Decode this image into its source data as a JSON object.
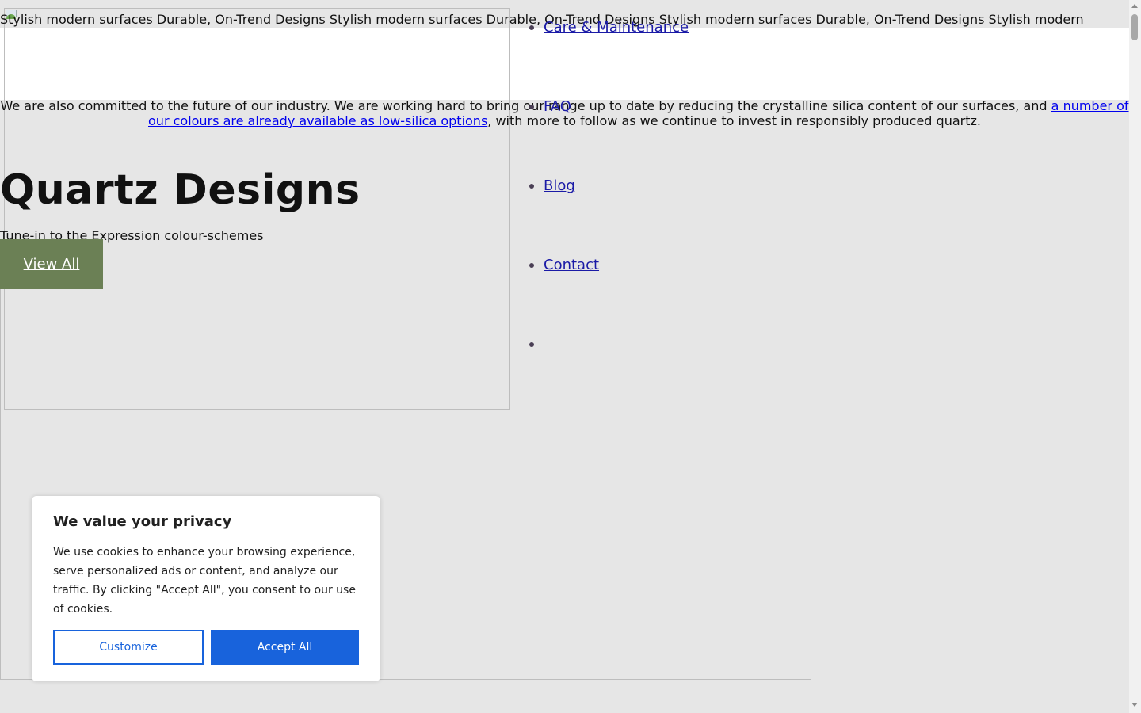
{
  "marquee": {
    "text": "Stylish modern surfaces Durable, On-Trend Designs Stylish modern surfaces Durable, On-Trend Designs Stylish modern surfaces Durable, On-Trend Designs Stylish modern"
  },
  "silica": {
    "text_before": "We are also committed to the future of our industry. We are working hard to bring our range up to date by reducing the crystalline silica content of our surfaces, and ",
    "link": "a number of our colours are already available as low-silica options",
    "text_after": ", with more to follow as we continue to invest in responsibly produced quartz."
  },
  "nav": {
    "items": [
      {
        "label": "Care & Maintenance"
      },
      {
        "label": "FAQ"
      },
      {
        "label": "Blog"
      },
      {
        "label": "Contact"
      },
      {
        "label": ""
      }
    ]
  },
  "hero": {
    "title": "Quartz Designs",
    "subtitle": "Tune-in to the Expression colour-schemes",
    "button": "View All"
  },
  "cookie": {
    "title": "We value your privacy",
    "body": "We use cookies to enhance your browsing experience, serve personalized ads or content, and analyze our traffic. By clicking \"Accept All\", you consent to our use of cookies.",
    "customize": "Customize",
    "accept": "Accept All"
  },
  "colors": {
    "background": "#e6e6e6",
    "view_all_button": "#6b8055",
    "accept_button": "#1863dc",
    "link": "#0000ee"
  }
}
